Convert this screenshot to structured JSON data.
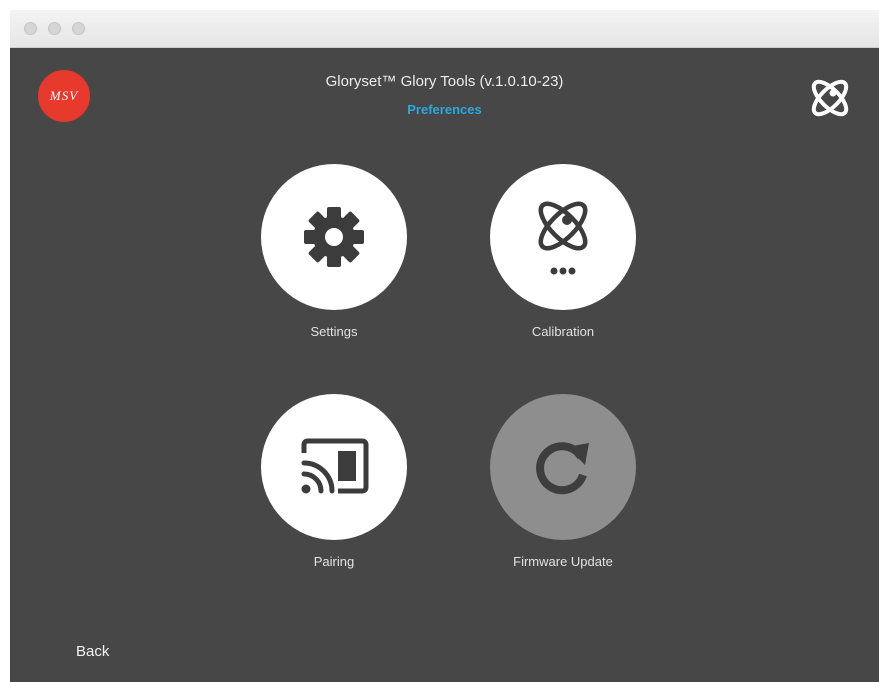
{
  "window": {
    "traffic_lights": [
      "close",
      "minimize",
      "maximize"
    ]
  },
  "header": {
    "logo_text": "MSV",
    "title": "Gloryset™ Glory Tools (v.1.0.10-23)",
    "subtitle": "Preferences",
    "brand_icon": "satellite-orbit-icon"
  },
  "tiles": [
    {
      "label": "Settings",
      "icon": "gear-icon"
    },
    {
      "label": "Calibration",
      "icon": "satellite-orbit-icon"
    },
    {
      "label": "Pairing",
      "icon": "cast-icon"
    },
    {
      "label": "Firmware Update",
      "icon": "refresh-icon"
    }
  ],
  "footer": {
    "back_label": "Back"
  },
  "colors": {
    "app_background": "#474747",
    "accent": "#2aa8e0",
    "logo_red": "#e8392d",
    "tile_white": "#ffffff",
    "tile_disabled": "#8e8e8e"
  }
}
